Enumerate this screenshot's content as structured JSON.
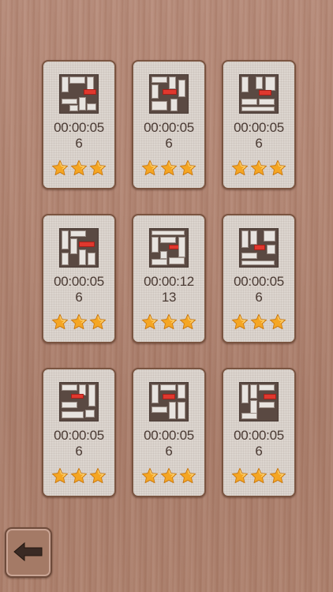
{
  "levels": [
    {
      "time_line1": "00:00:05",
      "time_line2": "6",
      "stars": 3
    },
    {
      "time_line1": "00:00:05",
      "time_line2": "6",
      "stars": 3
    },
    {
      "time_line1": "00:00:05",
      "time_line2": "6",
      "stars": 3
    },
    {
      "time_line1": "00:00:05",
      "time_line2": "6",
      "stars": 3
    },
    {
      "time_line1": "00:00:12",
      "time_line2": "13",
      "stars": 3
    },
    {
      "time_line1": "00:00:05",
      "time_line2": "6",
      "stars": 3
    },
    {
      "time_line1": "00:00:05",
      "time_line2": "6",
      "stars": 3
    },
    {
      "time_line1": "00:00:05",
      "time_line2": "6",
      "stars": 3
    },
    {
      "time_line1": "00:00:05",
      "time_line2": "6",
      "stars": 3
    }
  ],
  "icons": {
    "back": "left-arrow-icon",
    "star": "star-icon"
  },
  "colors": {
    "star": "#f5a623",
    "target_block": "#e0382e",
    "card_border": "#7a5440"
  }
}
